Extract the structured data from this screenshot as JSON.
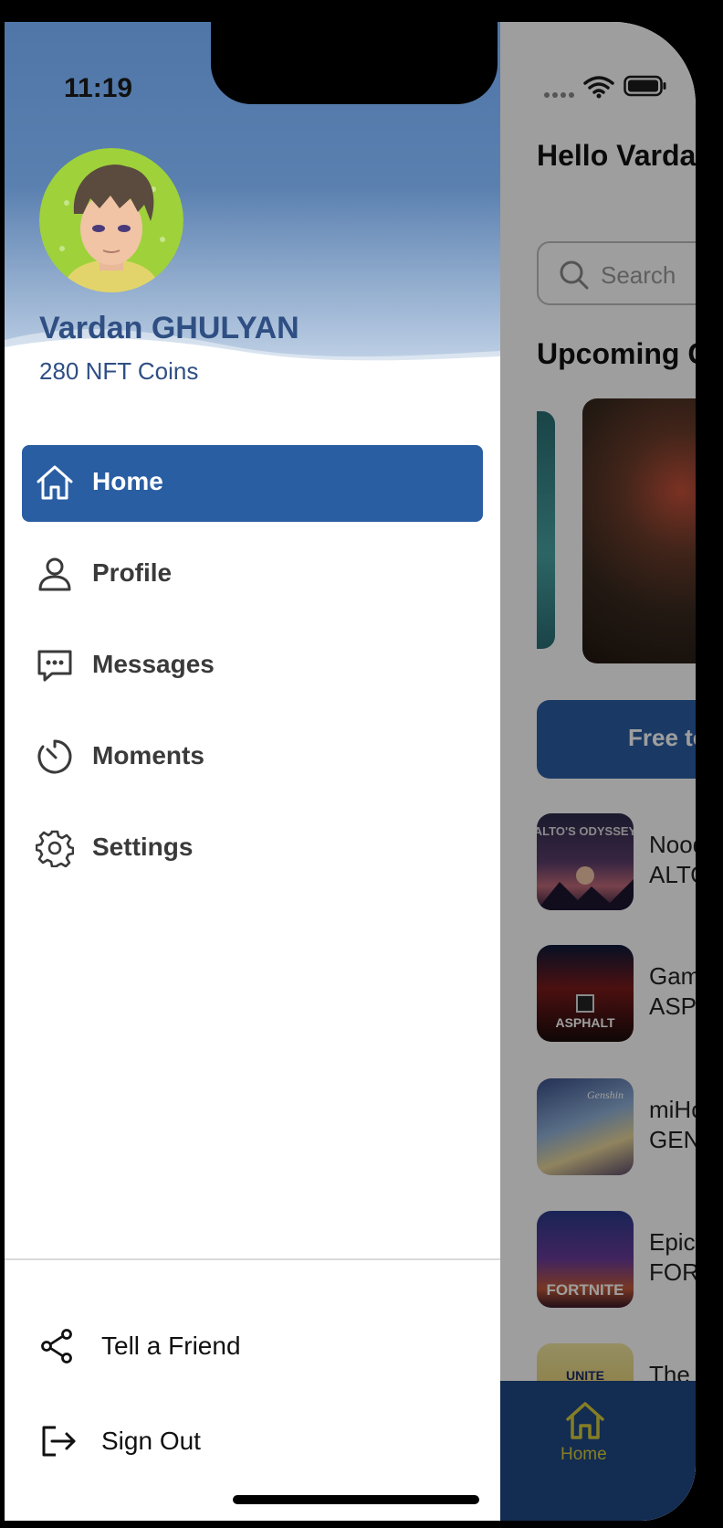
{
  "status_bar": {
    "time": "11:19"
  },
  "drawer": {
    "user": {
      "name": "Vardan GHULYAN",
      "coins": "280 NFT Coins"
    },
    "menu": [
      {
        "label": "Home",
        "icon": "home-icon",
        "active": true
      },
      {
        "label": "Profile",
        "icon": "person-icon",
        "active": false
      },
      {
        "label": "Messages",
        "icon": "chat-bubble-icon",
        "active": false
      },
      {
        "label": "Moments",
        "icon": "timer-icon",
        "active": false
      },
      {
        "label": "Settings",
        "icon": "gear-icon",
        "active": false
      }
    ],
    "footer": [
      {
        "label": "Tell a Friend",
        "icon": "share-icon"
      },
      {
        "label": "Sign Out",
        "icon": "sign-out-icon"
      }
    ]
  },
  "main": {
    "greeting": "Hello Varda",
    "search_placeholder": "Search",
    "section_title": "Upcoming G",
    "cta_label": "Free to",
    "games": [
      {
        "line1": "Nood",
        "line2": "ALTO"
      },
      {
        "line1": "Gam",
        "line2": "ASP"
      },
      {
        "line1": "miHo",
        "line2": "GEN"
      },
      {
        "line1": "Epic",
        "line2": "FORT"
      },
      {
        "line1": "The",
        "line2": ""
      }
    ],
    "game_thumb_text": [
      "ALTO'S ODYSSEY",
      "ASPHALT",
      "Genshin",
      "FORTNITE",
      "UNITE"
    ],
    "tabbar": {
      "home_label": "Home"
    }
  },
  "colors": {
    "accent": "#2a5ea3",
    "drawer_name": "#2f4f83",
    "tab_active": "#d7cc3e",
    "tabbar_bg": "#1f4784"
  }
}
